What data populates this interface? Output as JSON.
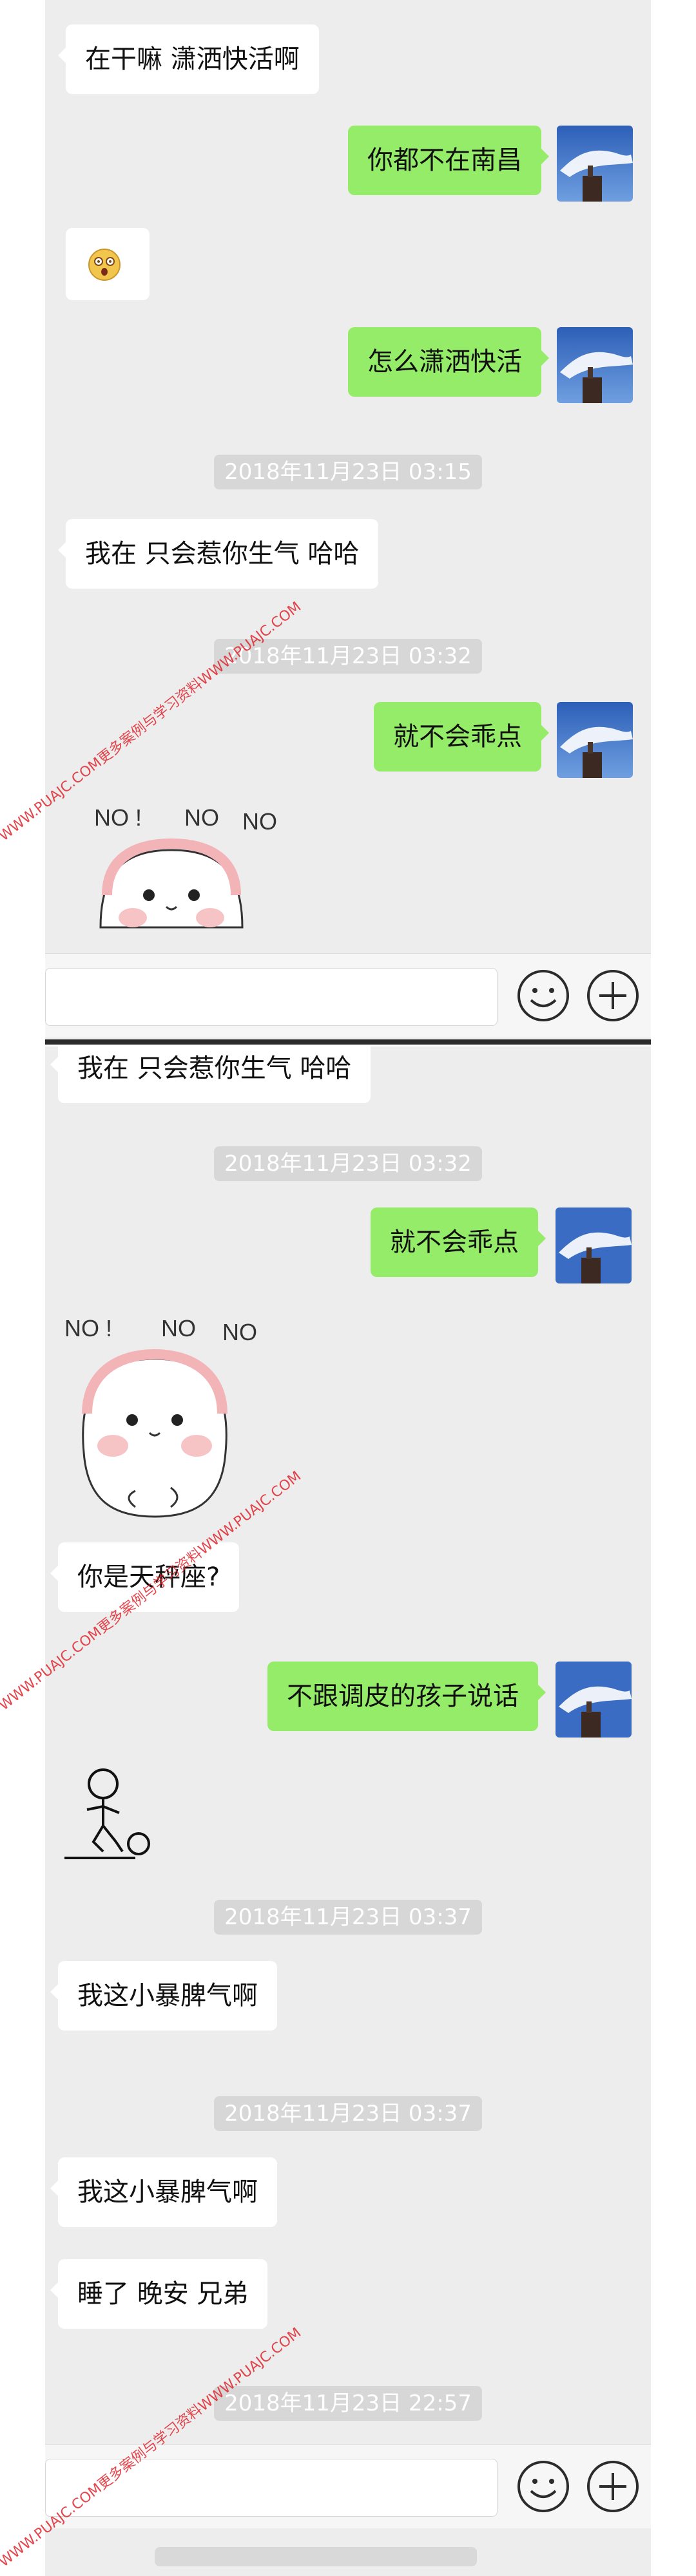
{
  "watermark": "WWW.PUAJC.COM更多案例与学习资料WWW.PUAJC.COM",
  "panel1": {
    "messages": [
      {
        "side": "left",
        "text": "在干嘛 潇洒快活啊"
      },
      {
        "side": "right",
        "text": "你都不在南昌"
      },
      {
        "side": "left",
        "type": "emoji",
        "icon": "dizzy-face-emoji"
      },
      {
        "side": "right",
        "text": "怎么潇洒快活"
      },
      {
        "type": "time",
        "text": "2018年11月23日 03:15"
      },
      {
        "side": "left",
        "text": "我在 只会惹你生气 哈哈"
      },
      {
        "type": "time",
        "text": "2018年11月23日 03:32"
      },
      {
        "side": "right",
        "text": "就不会乖点"
      },
      {
        "side": "left",
        "type": "sticker",
        "caption": [
          "NO !",
          "NO",
          "NO"
        ]
      }
    ]
  },
  "panel2": {
    "messages": [
      {
        "side": "left",
        "text": "我在 只会惹你生气 哈哈"
      },
      {
        "type": "time",
        "text": "2018年11月23日 03:32"
      },
      {
        "side": "right",
        "text": "就不会乖点"
      },
      {
        "side": "left",
        "type": "sticker",
        "caption": [
          "NO !",
          "NO",
          "NO"
        ]
      },
      {
        "side": "left",
        "text": "你是天秤座?"
      },
      {
        "side": "right",
        "text": "不跟调皮的孩子说话"
      },
      {
        "side": "left",
        "type": "sticker",
        "icon": "stick-figure-sticker"
      },
      {
        "type": "time",
        "text": "2018年11月23日 03:37"
      },
      {
        "side": "left",
        "text": "我这小暴脾气啊"
      },
      {
        "type": "time",
        "text": "2018年11月23日 03:37"
      },
      {
        "side": "left",
        "text": "我这小暴脾气啊"
      },
      {
        "side": "left",
        "text": "睡了 晚安 兄弟"
      },
      {
        "type": "time",
        "text": "2018年11月23日 22:57"
      }
    ]
  },
  "input_bar": {
    "emoji_icon": "emoji-icon",
    "add_icon": "plus-icon"
  }
}
